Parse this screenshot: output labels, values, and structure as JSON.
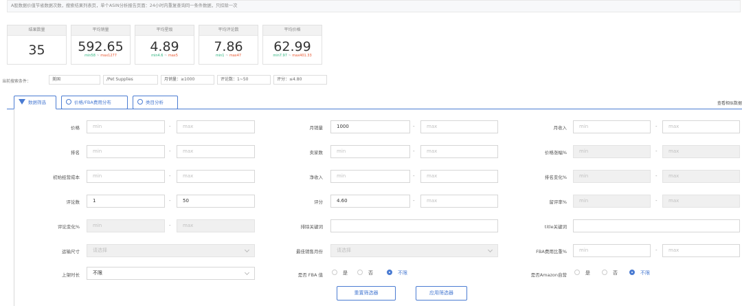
{
  "notice": "A股数据价值节省数据次数，搜索结果列表页，单个ASIN分析报告页面：24小时内重复查询同一条件数据，只扣除一次",
  "stats": [
    {
      "label": "结果数量",
      "value": "35",
      "min": "",
      "max": ""
    },
    {
      "label": "平均销量",
      "value": "592.65",
      "min": "min58",
      "max": "max1277"
    },
    {
      "label": "平均星级",
      "value": "4.89",
      "min": "min4.6",
      "max": "max5"
    },
    {
      "label": "平均评论数",
      "value": "7.86",
      "min": "min1",
      "max": "max47"
    },
    {
      "label": "平均价格",
      "value": "62.99",
      "min": "min7.97",
      "max": "max401.33"
    }
  ],
  "stats_separator": " ~ ",
  "conditions_label": "当前搜索条件：",
  "conditions": [
    "美国",
    "/Pet Supplies",
    "月销量：≥1000",
    "评论数：1~50",
    "评分：≤4.80"
  ],
  "tabs": [
    {
      "label": "数据筛选",
      "icon": "filter-icon"
    },
    {
      "label": "价格/FBA费用分布",
      "icon": "dollar-circle-icon"
    },
    {
      "label": "类目分析",
      "icon": "chart-circle-icon"
    }
  ],
  "tabs_right": "查看相似数据",
  "placeholders": {
    "min": "min",
    "max": "max",
    "select": "请选择"
  },
  "dash": "-",
  "fields": {
    "price": {
      "label": "价格",
      "min": "",
      "max": ""
    },
    "monthly_sales": {
      "label": "月销量",
      "min": "1000",
      "max": ""
    },
    "monthly_revenue": {
      "label": "月收入",
      "min": "",
      "max": ""
    },
    "rank": {
      "label": "排名",
      "min": "",
      "max": ""
    },
    "sellers": {
      "label": "卖家数",
      "min": "",
      "max": ""
    },
    "price_change": {
      "label": "价格涨幅%",
      "min": "",
      "max": ""
    },
    "shipping_cost": {
      "label": "初始经营成本",
      "min": "",
      "max": ""
    },
    "net_income": {
      "label": "净收入",
      "min": "",
      "max": ""
    },
    "rank_change": {
      "label": "排名变化%",
      "min": "",
      "max": ""
    },
    "reviews": {
      "label": "评论数",
      "min": "1",
      "max": "50"
    },
    "rating": {
      "label": "评分",
      "min": "4.60",
      "max": ""
    },
    "review_rate": {
      "label": "留评率%",
      "min": "",
      "max": ""
    },
    "review_change": {
      "label": "评论变化%",
      "min": "",
      "max": ""
    },
    "exclude_keywords": {
      "label": "排除关键词",
      "value": ""
    },
    "title_keywords": {
      "label": "title关键词",
      "value": ""
    },
    "size": {
      "label": "运输尺寸",
      "value": ""
    },
    "sales_month": {
      "label": "最佳销售月份",
      "value": ""
    },
    "fba_ratio": {
      "label": "FBA费用比重%",
      "min": "",
      "max": ""
    },
    "listing_time": {
      "label": "上架时长",
      "value": "不限"
    }
  },
  "fba_group": {
    "label": "是否 FBA 值",
    "options": [
      "是",
      "否",
      "不限"
    ],
    "selected": 2
  },
  "amazon_group": {
    "label": "是否Amazon自营",
    "options": [
      "是",
      "否",
      "不限"
    ],
    "selected": 2
  },
  "buttons": {
    "reset": "重置筛选器",
    "apply": "应用筛选器"
  },
  "colors": {
    "accent": "#4a7bd2",
    "min": "#2ab27b",
    "max": "#e8552d"
  }
}
